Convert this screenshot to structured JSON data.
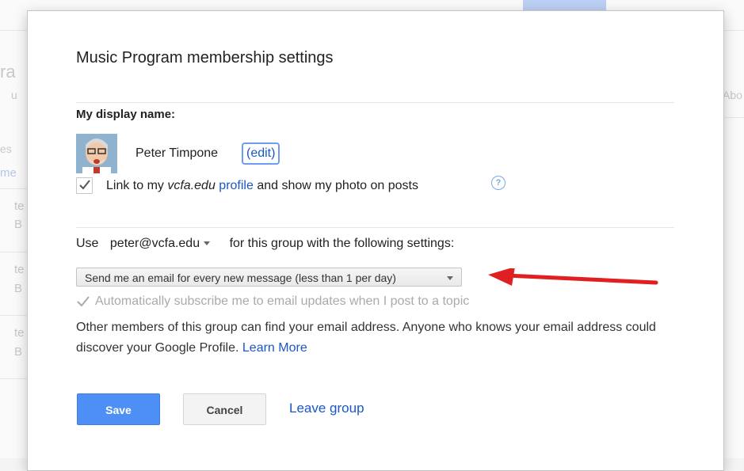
{
  "background": {
    "top_button_color": "#bcd0f5",
    "fragments": [
      "ra",
      "u",
      "es",
      "me",
      "te",
      "B",
      "te",
      "B",
      "te",
      "B",
      "Abo"
    ]
  },
  "dialog": {
    "title": "Music Program membership settings",
    "display_name_label": "My display name:",
    "user_name": "Peter Timpone",
    "edit_label": "(edit)",
    "link_profile": {
      "checked": true,
      "prefix": "Link to my ",
      "domain": "vcfa.edu",
      "profile_link": "profile",
      "suffix": " and show my photo on posts"
    },
    "help_icon": "?",
    "use_row": {
      "prefix": "Use",
      "email": "peter@vcfa.edu",
      "suffix": "for this group with the following settings:"
    },
    "delivery_select": {
      "selected": "Send me an email for every new message (less than 1 per day)"
    },
    "auto_subscribe": {
      "checked": true,
      "disabled": true,
      "label": "Automatically subscribe me to email updates when I post to a topic"
    },
    "notice": {
      "text": "Other members of this group can find your email address. Anyone who knows your email address could discover your Google Profile.",
      "learn_more": "Learn More"
    },
    "buttons": {
      "save": "Save",
      "cancel": "Cancel",
      "leave": "Leave group"
    }
  },
  "colors": {
    "primary_button": "#4d8ff5",
    "link": "#1a56c8",
    "annotation_arrow": "#e02020"
  }
}
